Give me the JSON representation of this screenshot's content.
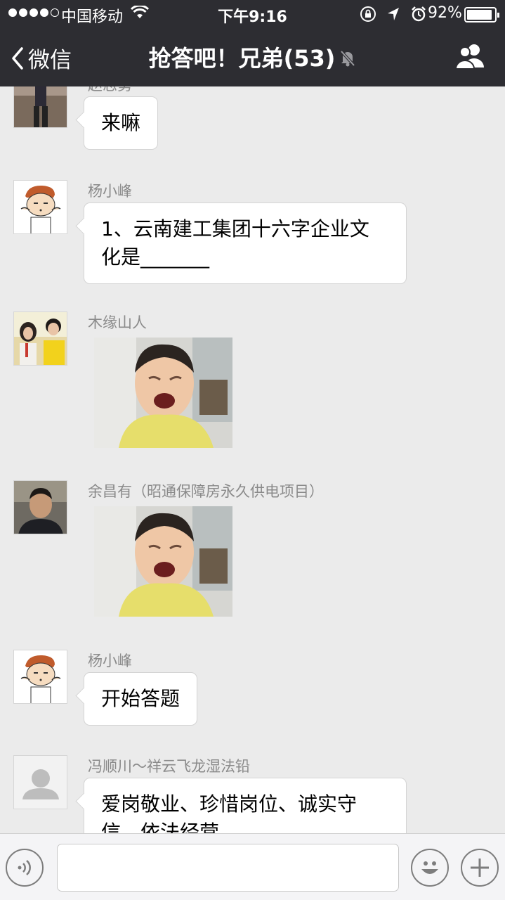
{
  "status_bar": {
    "carrier": "中国移动",
    "time": "下午9:16",
    "battery": "92%",
    "battery_level": 0.92
  },
  "nav": {
    "back_label": "微信",
    "title": "抢答吧！兄弟(53)"
  },
  "messages": [
    {
      "sender": "赵志勇",
      "text": "来嘛"
    },
    {
      "sender": "杨小峰",
      "text_line1": "1、云南建工集团十六字企业文",
      "text_line2": "化是_______"
    },
    {
      "sender": "木缘山人",
      "type": "sticker"
    },
    {
      "sender": "余昌有（昭通保障房永久供电项目）",
      "type": "sticker"
    },
    {
      "sender": "杨小峰",
      "text": "开始答题"
    },
    {
      "sender": "冯顺川～祥云飞龙湿法铅",
      "text_line1": "爱岗敬业、珍惜岗位、诚实守",
      "text_line2": "信、依法经营"
    }
  ],
  "colors": {
    "nav_bg": "#2d2d32",
    "chat_bg": "#ebebeb",
    "bubble_bg": "#ffffff",
    "sender_text": "#8a8a8a"
  }
}
